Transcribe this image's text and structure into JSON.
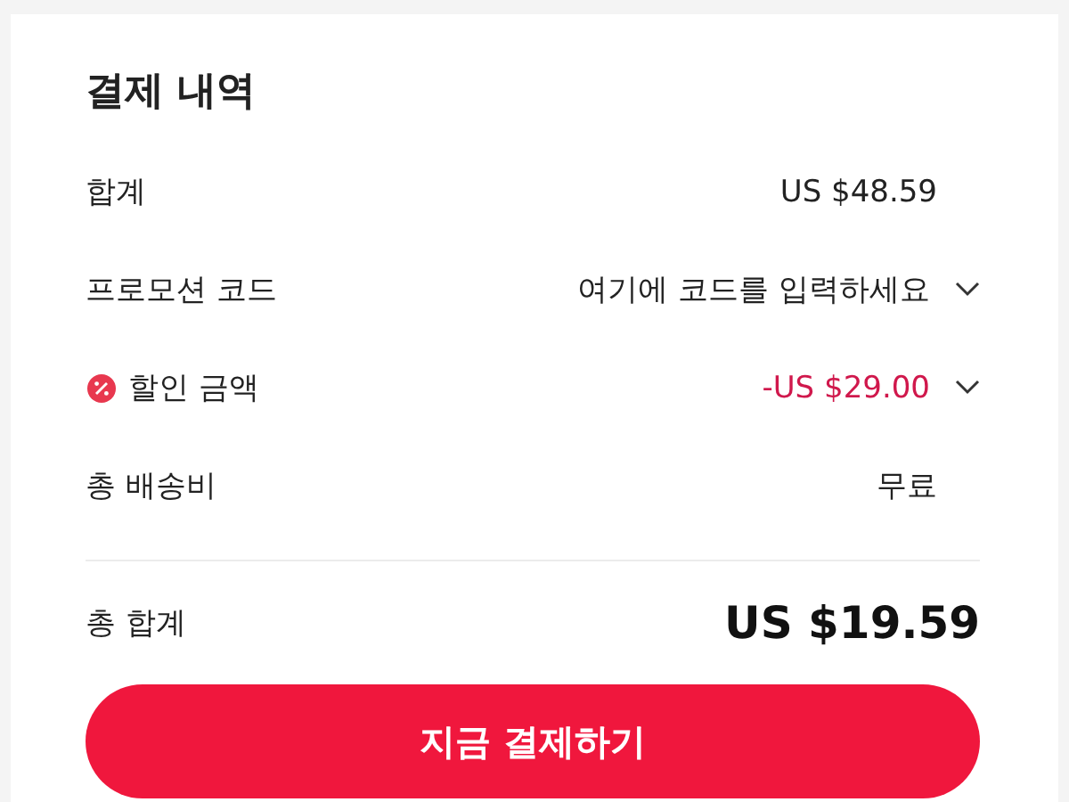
{
  "title": "결제 내역",
  "rows": [
    {
      "kind": "plain",
      "label": "합계",
      "value": "US $48.59"
    },
    {
      "kind": "dropdown",
      "label": "프로모션 코드",
      "value": "여기에 코드를 입력하세요"
    },
    {
      "kind": "discount",
      "label": "할인 금액",
      "value": "-US $29.00"
    },
    {
      "kind": "plain",
      "label": "총 배송비",
      "value": "무료"
    }
  ],
  "total": {
    "label": "총 합계",
    "value": "US $19.59"
  },
  "pay_button": "지금 결제하기"
}
